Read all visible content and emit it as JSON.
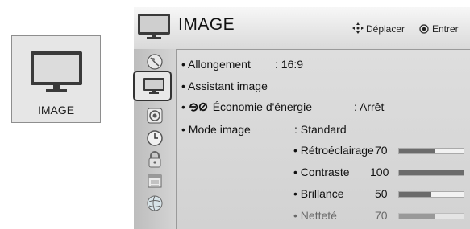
{
  "thumbnail": {
    "label": "IMAGE",
    "icon": "tv-icon"
  },
  "header": {
    "title": "IMAGE",
    "move_hint": "Déplacer",
    "enter_hint": "Entrer",
    "move_icon": "dpad-icon",
    "enter_icon": "ok-button-icon"
  },
  "sidebar": {
    "items": [
      {
        "name": "satellite-dish-icon"
      },
      {
        "name": "tv-icon",
        "selected": true
      },
      {
        "name": "speaker-icon"
      },
      {
        "name": "clock-icon"
      },
      {
        "name": "lock-icon"
      },
      {
        "name": "calendar-icon"
      },
      {
        "name": "globe-icon"
      }
    ]
  },
  "settings": {
    "aspect": {
      "label": "Allongement",
      "value": ": 16:9"
    },
    "assistant": {
      "label": "Assistant image"
    },
    "energy": {
      "label": "Économie d'énergie",
      "value": ": Arrêt",
      "logo": "eco-logo"
    },
    "mode": {
      "label": "Mode image",
      "value": ": Standard"
    },
    "backlight": {
      "label": "Rétroéclairage",
      "value": "70",
      "level": 0.55
    },
    "contrast": {
      "label": "Contraste",
      "value": "100",
      "level": 1.0
    },
    "brightness": {
      "label": "Brillance",
      "value": "50",
      "level": 0.5
    },
    "sharpness": {
      "label": "Netteté",
      "value": "70",
      "level": 0.55
    }
  },
  "colors": {
    "bar_fill": "#6b6b6b",
    "bar_bg": "#f2f2f2",
    "header_text": "#111111"
  }
}
